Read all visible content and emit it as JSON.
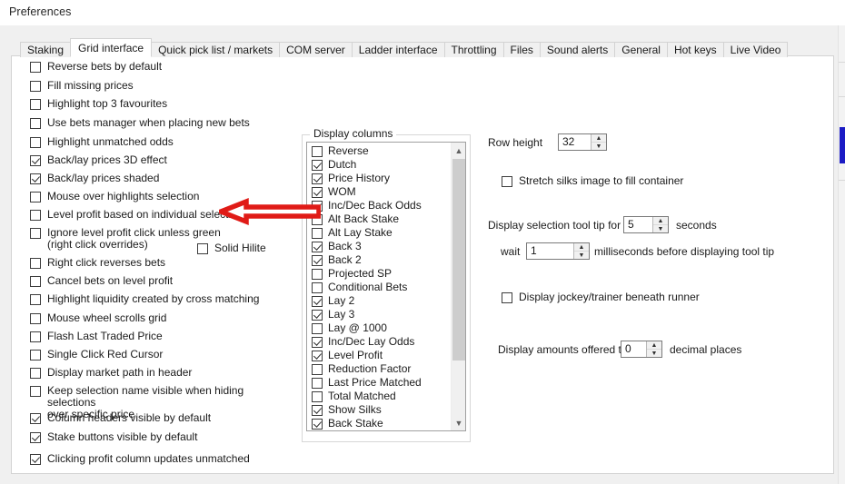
{
  "window": {
    "title": "Preferences"
  },
  "tabs": [
    {
      "label": "Staking",
      "active": false
    },
    {
      "label": "Grid interface",
      "active": true
    },
    {
      "label": "Quick pick list / markets",
      "active": false
    },
    {
      "label": "COM server",
      "active": false
    },
    {
      "label": "Ladder interface",
      "active": false
    },
    {
      "label": "Throttling",
      "active": false
    },
    {
      "label": "Files",
      "active": false
    },
    {
      "label": "Sound alerts",
      "active": false
    },
    {
      "label": "General",
      "active": false
    },
    {
      "label": "Hot keys",
      "active": false
    },
    {
      "label": "Live Video",
      "active": false
    }
  ],
  "left_options": [
    {
      "label": "Reverse bets by default",
      "checked": false
    },
    {
      "label": "Fill missing prices",
      "checked": false
    },
    {
      "label": "Highlight top 3 favourites",
      "checked": false
    },
    {
      "label": "Use bets manager when placing new bets",
      "checked": false
    },
    {
      "label": "Highlight unmatched odds",
      "checked": false
    },
    {
      "label": "Back/lay prices 3D effect",
      "checked": true
    },
    {
      "label": "Back/lay prices shaded",
      "checked": true
    },
    {
      "label": "Mouse over highlights selection",
      "checked": false
    },
    {
      "label": "Level profit based on individual selection",
      "checked": false
    },
    {
      "label": "Ignore level profit click unless green\n(right click overrides)",
      "checked": false
    },
    {
      "label": "Right click reverses bets",
      "checked": false
    },
    {
      "label": "Cancel bets on level profit",
      "checked": false
    },
    {
      "label": "Highlight liquidity created by cross matching",
      "checked": false
    },
    {
      "label": "Mouse wheel scrolls grid",
      "checked": false
    },
    {
      "label": "Flash Last Traded Price",
      "checked": false
    },
    {
      "label": "Single Click Red Cursor",
      "checked": false
    },
    {
      "label": "Display market path in header",
      "checked": false
    },
    {
      "label": "Keep selection name visible when hiding selections\nover specific price",
      "checked": false
    },
    {
      "label": "Column headers visible by default",
      "checked": true
    },
    {
      "label": "Stake buttons visible by default",
      "checked": true
    },
    {
      "label": "Clicking profit column updates unmatched",
      "checked": true
    }
  ],
  "solid_hilite": {
    "label": "Solid Hilite",
    "checked": false
  },
  "display_columns": {
    "caption": "Display columns",
    "items": [
      {
        "label": "Reverse",
        "checked": false
      },
      {
        "label": "Dutch",
        "checked": true
      },
      {
        "label": "Price History",
        "checked": true
      },
      {
        "label": "WOM",
        "checked": true
      },
      {
        "label": "Inc/Dec Back Odds",
        "checked": true
      },
      {
        "label": "Alt Back Stake",
        "checked": false
      },
      {
        "label": "Alt Lay Stake",
        "checked": false
      },
      {
        "label": "Back 3",
        "checked": true
      },
      {
        "label": "Back 2",
        "checked": true
      },
      {
        "label": "Projected SP",
        "checked": false
      },
      {
        "label": "Conditional Bets",
        "checked": false
      },
      {
        "label": "Lay 2",
        "checked": true
      },
      {
        "label": "Lay 3",
        "checked": true
      },
      {
        "label": "Lay @ 1000",
        "checked": false
      },
      {
        "label": "Inc/Dec Lay Odds",
        "checked": true
      },
      {
        "label": "Level Profit",
        "checked": true
      },
      {
        "label": "Reduction Factor",
        "checked": false
      },
      {
        "label": "Last Price Matched",
        "checked": false
      },
      {
        "label": "Total Matched",
        "checked": false
      },
      {
        "label": "Show Silks",
        "checked": true
      },
      {
        "label": "Back Stake",
        "checked": true
      }
    ]
  },
  "right_panel": {
    "row_height_label": "Row height",
    "row_height_value": "32",
    "stretch_silks_label": "Stretch silks image to fill container",
    "stretch_silks_checked": false,
    "tooltip_prefix": "Display selection tool tip for",
    "tooltip_value": "5",
    "tooltip_suffix": "seconds",
    "wait_prefix": "wait",
    "wait_value": "1",
    "wait_suffix": "milliseconds before displaying tool tip",
    "jockey_label": "Display jockey/trainer beneath runner",
    "jockey_checked": false,
    "decimals_prefix": "Display amounts offered to",
    "decimals_value": "0",
    "decimals_suffix": "decimal places"
  },
  "annotation": {
    "arrow_color": "#e01b17",
    "arrow_direction": "left",
    "points_at": "Level profit based on individual selection"
  },
  "scrollbar": {
    "thumb_color": "#1b1bc4"
  }
}
